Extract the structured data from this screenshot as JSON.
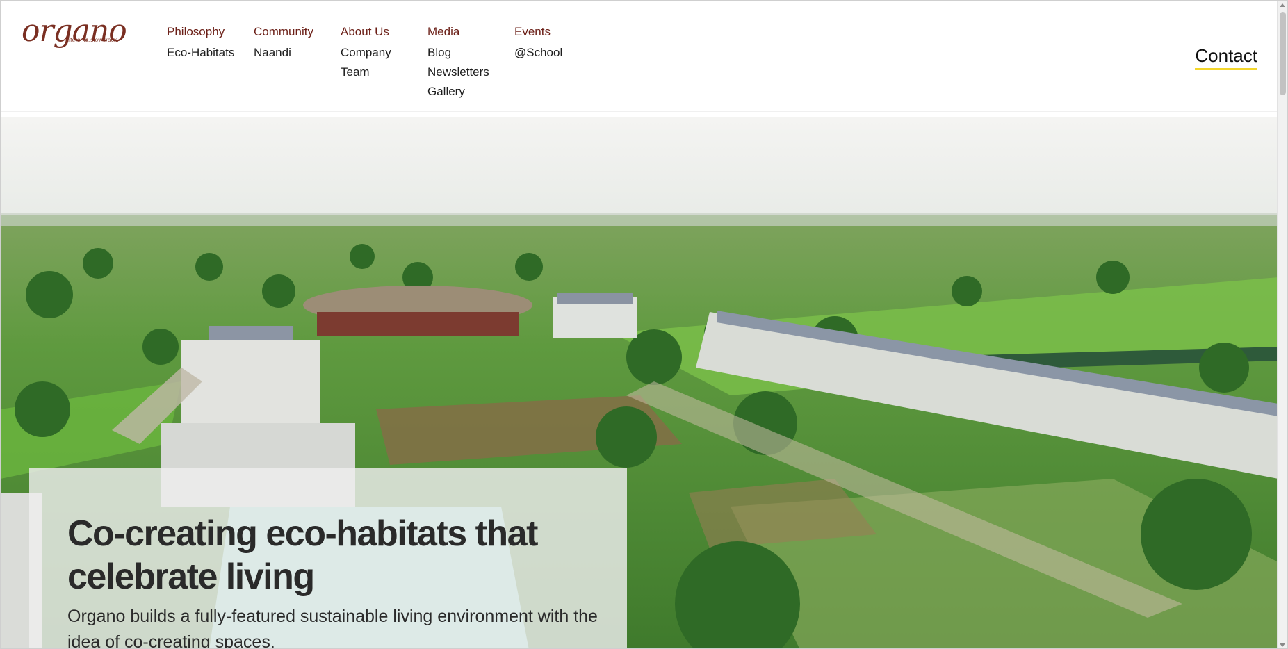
{
  "brand": {
    "name": "organo",
    "tagline": "life.on.a.slow.track.",
    "color": "#7a2f22"
  },
  "nav": [
    {
      "heading": "Philosophy",
      "links": [
        "Eco-Habitats"
      ]
    },
    {
      "heading": "Community",
      "links": [
        "Naandi"
      ]
    },
    {
      "heading": "About Us",
      "links": [
        "Company",
        "Team"
      ]
    },
    {
      "heading": "Media",
      "links": [
        "Blog",
        "Newsletters",
        "Gallery"
      ]
    },
    {
      "heading": "Events",
      "links": [
        "@School"
      ]
    }
  ],
  "contact": {
    "label": "Contact",
    "underline_color": "#f3d62a"
  },
  "hero": {
    "title": "Co-creating eco-habitats that celebrate living",
    "subtitle": "Organo builds a fully-featured sustainable living environment with the idea of co-creating spaces.",
    "image": "aerial-eco-habitat-photo"
  },
  "colors": {
    "nav_heading": "#6b1f17",
    "nav_link": "#1e1e1e",
    "text": "#2a2a2a"
  }
}
